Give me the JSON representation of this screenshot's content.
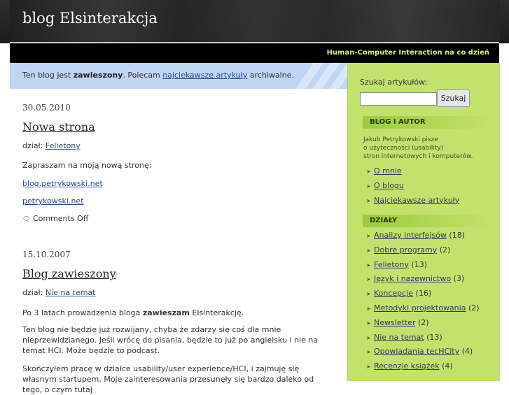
{
  "header": {
    "title": "blog Elsinterakcja",
    "tagline": "Human-Computer Interaction na co dzień"
  },
  "notice": {
    "prefix": "Ten blog jest ",
    "bold": "zawieszony",
    "middle": ". Polecam ",
    "link": "najciekawsze artykuły",
    "suffix": " archiwalne."
  },
  "posts": [
    {
      "date": "30.05.2010",
      "title": "Nowa strona",
      "category_label": "dział: ",
      "category": "Felietony",
      "body": "Zapraszam na moją nową stronę:",
      "links": [
        "blog.petrykowski.net",
        "petrykowski.net"
      ],
      "comments": "Comments Off"
    },
    {
      "date": "15.10.2007",
      "title": "Blog zawieszony",
      "category_label": "dział: ",
      "category": "Nie na temat",
      "p1_prefix": "Po 3 latach prowadzenia bloga ",
      "p1_bold": "zawieszam",
      "p1_suffix": " Elsinterakcję.",
      "p2": "Ten blog nie będzie już rozwijany, chyba że zdarzy się coś dla mnie nieprzewidzianego. Jeśli wrócę do pisania, będzie to już po angielsku i nie na temat HCI. Może będzie to podcast.",
      "p3": "Skończyłem pracę w działce usability/user experience/HCI, i zajmuję się własnym startupem. Moje zainteresowania przesunęły się bardzo daleko od tego, o czym tutaj"
    }
  ],
  "sidebar": {
    "search_label": "Szukaj artykułów:",
    "search_value": "",
    "search_button": "Szukaj",
    "blog_heading": "BLOG I AUTOR",
    "blog_desc": [
      "Jakub Petrykowski pisze",
      "o użyteczności (usability)",
      "stron internetowych i komputerów."
    ],
    "blog_links": [
      "O mnie",
      "O blogu",
      "Najciekawsze artykuły"
    ],
    "categories_heading": "DZIAŁY",
    "categories": [
      {
        "name": "Analizy interfejsów",
        "count": "(18)"
      },
      {
        "name": "Dobre programy",
        "count": "(2)"
      },
      {
        "name": "Felietony",
        "count": "(13)"
      },
      {
        "name": "Język i nazewnictwo",
        "count": "(3)"
      },
      {
        "name": "Koncepcje",
        "count": "(16)"
      },
      {
        "name": "Metodyki projektowania",
        "count": "(2)"
      },
      {
        "name": "Newsletter",
        "count": "(2)"
      },
      {
        "name": "Nie na temat",
        "count": "(13)"
      },
      {
        "name": "Opowiadania tecHClty",
        "count": "(4)"
      },
      {
        "name": "Recenzje książek",
        "count": "(4)"
      }
    ]
  },
  "colors": {
    "sidebar_bg": "#c3e26d",
    "notice_bg": "#c0d5f4",
    "tagline": "#d7f27a",
    "link": "#2a4b8d"
  }
}
